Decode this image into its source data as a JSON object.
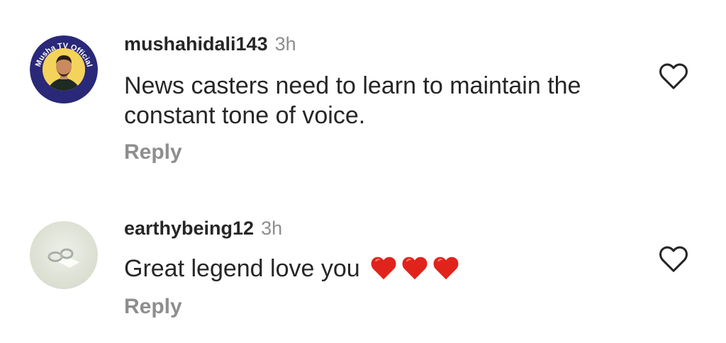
{
  "comments": [
    {
      "username": "mushahidali143",
      "timestamp": "3h",
      "text": "News casters need to learn to maintain the constant tone of voice.",
      "reply_label": "Reply",
      "avatar": {
        "badge_text": "Musha TV Official",
        "ring_color": "#2a2878",
        "bg_color": "#f0c23a"
      }
    },
    {
      "username": "earthybeing12",
      "timestamp": "3h",
      "text": "Great legend love you",
      "emojis": [
        "red-heart",
        "red-heart",
        "red-heart"
      ],
      "reply_label": "Reply",
      "avatar": {
        "bg_color": "#dfe4d8"
      }
    }
  ],
  "colors": {
    "text": "#262626",
    "muted": "#8e8e8e",
    "heart_emoji": "#e0241b"
  },
  "icons": {
    "like": "heart-outline-icon"
  }
}
